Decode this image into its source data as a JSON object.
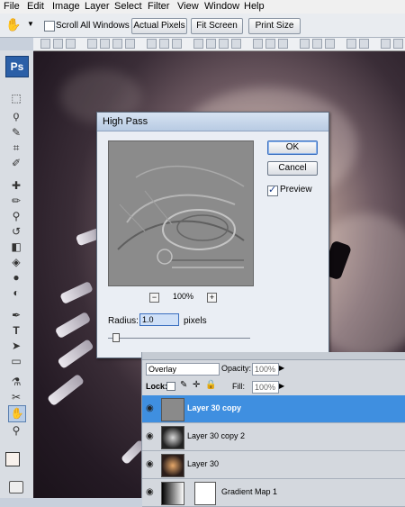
{
  "menu": [
    "File",
    "Edit",
    "Image",
    "Layer",
    "Select",
    "Filter",
    "View",
    "Window",
    "Help"
  ],
  "options": {
    "scroll_all_label": "Scroll All Windows",
    "actual_pixels": "Actual Pixels",
    "fit_screen": "Fit Screen",
    "print_size": "Print Size"
  },
  "toolbox": {
    "logo": "Ps",
    "tools": [
      "hand-icon",
      "marquee-icon",
      "lasso-icon",
      "magic-wand-icon",
      "crop-icon",
      "eyedropper-icon",
      "healing-brush-icon",
      "brush-icon",
      "clone-stamp-icon",
      "history-brush-icon",
      "eraser-icon",
      "paint-bucket-icon",
      "blur-icon",
      "dodge-icon",
      "pen-icon",
      "type-icon",
      "path-select-icon",
      "shape-icon",
      "eyedropper-3d-icon",
      "measure-icon",
      "hand-tool-icon",
      "zoom-icon"
    ]
  },
  "dialog": {
    "title": "High Pass",
    "ok": "OK",
    "cancel": "Cancel",
    "preview_label": "Preview",
    "zoom": "100%",
    "zoom_out": "−",
    "zoom_in": "+",
    "radius_label": "Radius:",
    "radius_value": "1.0",
    "radius_unit": "pixels"
  },
  "layers": {
    "blend_mode": "Overlay",
    "opacity_label": "Opacity:",
    "opacity_value": "100%",
    "lock_label": "Lock:",
    "fill_label": "Fill:",
    "fill_value": "100%",
    "rows": [
      {
        "name": "Layer 30 copy"
      },
      {
        "name": "Layer 30 copy 2"
      },
      {
        "name": "Layer 30"
      },
      {
        "name": "Gradient Map 1"
      }
    ]
  }
}
